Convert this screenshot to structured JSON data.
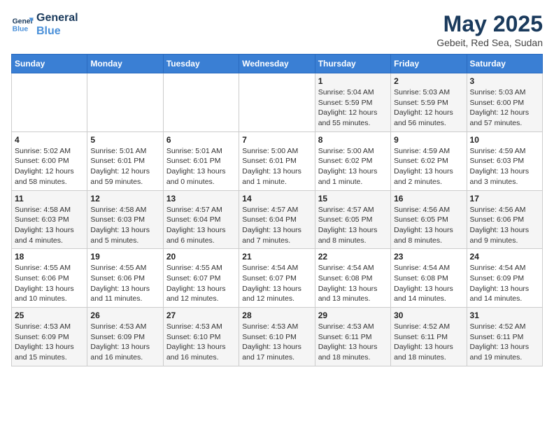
{
  "header": {
    "logo_line1": "General",
    "logo_line2": "Blue",
    "month": "May 2025",
    "location": "Gebeit, Red Sea, Sudan"
  },
  "days_of_week": [
    "Sunday",
    "Monday",
    "Tuesday",
    "Wednesday",
    "Thursday",
    "Friday",
    "Saturday"
  ],
  "weeks": [
    [
      {
        "day": "",
        "info": ""
      },
      {
        "day": "",
        "info": ""
      },
      {
        "day": "",
        "info": ""
      },
      {
        "day": "",
        "info": ""
      },
      {
        "day": "1",
        "info": "Sunrise: 5:04 AM\nSunset: 5:59 PM\nDaylight: 12 hours and 55 minutes."
      },
      {
        "day": "2",
        "info": "Sunrise: 5:03 AM\nSunset: 5:59 PM\nDaylight: 12 hours and 56 minutes."
      },
      {
        "day": "3",
        "info": "Sunrise: 5:03 AM\nSunset: 6:00 PM\nDaylight: 12 hours and 57 minutes."
      }
    ],
    [
      {
        "day": "4",
        "info": "Sunrise: 5:02 AM\nSunset: 6:00 PM\nDaylight: 12 hours and 58 minutes."
      },
      {
        "day": "5",
        "info": "Sunrise: 5:01 AM\nSunset: 6:01 PM\nDaylight: 12 hours and 59 minutes."
      },
      {
        "day": "6",
        "info": "Sunrise: 5:01 AM\nSunset: 6:01 PM\nDaylight: 13 hours and 0 minutes."
      },
      {
        "day": "7",
        "info": "Sunrise: 5:00 AM\nSunset: 6:01 PM\nDaylight: 13 hours and 1 minute."
      },
      {
        "day": "8",
        "info": "Sunrise: 5:00 AM\nSunset: 6:02 PM\nDaylight: 13 hours and 1 minute."
      },
      {
        "day": "9",
        "info": "Sunrise: 4:59 AM\nSunset: 6:02 PM\nDaylight: 13 hours and 2 minutes."
      },
      {
        "day": "10",
        "info": "Sunrise: 4:59 AM\nSunset: 6:03 PM\nDaylight: 13 hours and 3 minutes."
      }
    ],
    [
      {
        "day": "11",
        "info": "Sunrise: 4:58 AM\nSunset: 6:03 PM\nDaylight: 13 hours and 4 minutes."
      },
      {
        "day": "12",
        "info": "Sunrise: 4:58 AM\nSunset: 6:03 PM\nDaylight: 13 hours and 5 minutes."
      },
      {
        "day": "13",
        "info": "Sunrise: 4:57 AM\nSunset: 6:04 PM\nDaylight: 13 hours and 6 minutes."
      },
      {
        "day": "14",
        "info": "Sunrise: 4:57 AM\nSunset: 6:04 PM\nDaylight: 13 hours and 7 minutes."
      },
      {
        "day": "15",
        "info": "Sunrise: 4:57 AM\nSunset: 6:05 PM\nDaylight: 13 hours and 8 minutes."
      },
      {
        "day": "16",
        "info": "Sunrise: 4:56 AM\nSunset: 6:05 PM\nDaylight: 13 hours and 8 minutes."
      },
      {
        "day": "17",
        "info": "Sunrise: 4:56 AM\nSunset: 6:06 PM\nDaylight: 13 hours and 9 minutes."
      }
    ],
    [
      {
        "day": "18",
        "info": "Sunrise: 4:55 AM\nSunset: 6:06 PM\nDaylight: 13 hours and 10 minutes."
      },
      {
        "day": "19",
        "info": "Sunrise: 4:55 AM\nSunset: 6:06 PM\nDaylight: 13 hours and 11 minutes."
      },
      {
        "day": "20",
        "info": "Sunrise: 4:55 AM\nSunset: 6:07 PM\nDaylight: 13 hours and 12 minutes."
      },
      {
        "day": "21",
        "info": "Sunrise: 4:54 AM\nSunset: 6:07 PM\nDaylight: 13 hours and 12 minutes."
      },
      {
        "day": "22",
        "info": "Sunrise: 4:54 AM\nSunset: 6:08 PM\nDaylight: 13 hours and 13 minutes."
      },
      {
        "day": "23",
        "info": "Sunrise: 4:54 AM\nSunset: 6:08 PM\nDaylight: 13 hours and 14 minutes."
      },
      {
        "day": "24",
        "info": "Sunrise: 4:54 AM\nSunset: 6:09 PM\nDaylight: 13 hours and 14 minutes."
      }
    ],
    [
      {
        "day": "25",
        "info": "Sunrise: 4:53 AM\nSunset: 6:09 PM\nDaylight: 13 hours and 15 minutes."
      },
      {
        "day": "26",
        "info": "Sunrise: 4:53 AM\nSunset: 6:09 PM\nDaylight: 13 hours and 16 minutes."
      },
      {
        "day": "27",
        "info": "Sunrise: 4:53 AM\nSunset: 6:10 PM\nDaylight: 13 hours and 16 minutes."
      },
      {
        "day": "28",
        "info": "Sunrise: 4:53 AM\nSunset: 6:10 PM\nDaylight: 13 hours and 17 minutes."
      },
      {
        "day": "29",
        "info": "Sunrise: 4:53 AM\nSunset: 6:11 PM\nDaylight: 13 hours and 18 minutes."
      },
      {
        "day": "30",
        "info": "Sunrise: 4:52 AM\nSunset: 6:11 PM\nDaylight: 13 hours and 18 minutes."
      },
      {
        "day": "31",
        "info": "Sunrise: 4:52 AM\nSunset: 6:11 PM\nDaylight: 13 hours and 19 minutes."
      }
    ]
  ]
}
